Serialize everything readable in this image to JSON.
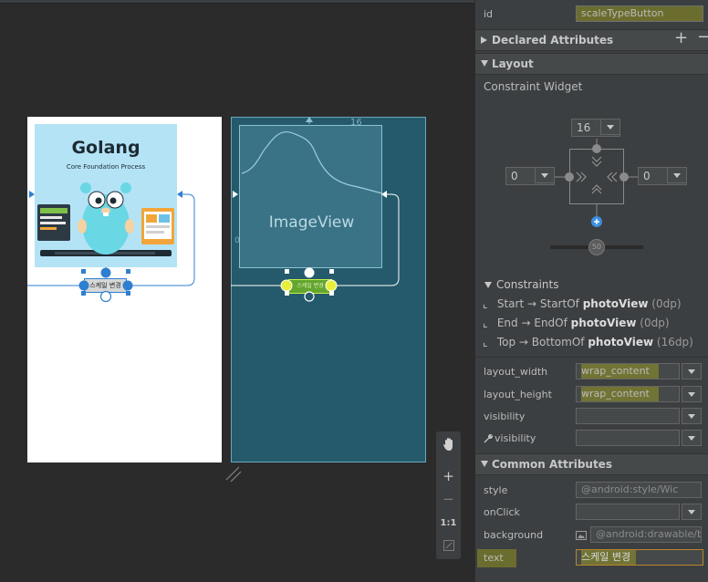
{
  "canvas": {
    "design": {
      "photo_title": "Golang",
      "photo_subtitle": "Core Foundation Process",
      "button_text": "스케일 변경"
    },
    "blueprint": {
      "image_label": "ImageView",
      "button_text": "스케일 변경",
      "top_margin": "16",
      "side_margin": "0"
    },
    "zoom": {
      "zoom_in": "+",
      "zoom_out": "−",
      "one_to_one": "1:1"
    }
  },
  "panel": {
    "id_label": "id",
    "id_value": "scaleTypeButton",
    "declared_header": "Declared Attributes",
    "add_symbol": "+",
    "remove_symbol": "−",
    "layout_header": "Layout",
    "constraint_widget_label": "Constraint Widget",
    "margin_top": "16",
    "margin_start": "0",
    "margin_end": "0",
    "bias": "50",
    "constraints_header": "Constraints",
    "constraints": [
      {
        "anchor": "Start",
        "arrow": "→",
        "target": "StartOf",
        "view": "photoView",
        "value": "(0dp)"
      },
      {
        "anchor": "End",
        "arrow": "→",
        "target": "EndOf",
        "view": "photoView",
        "value": "(0dp)"
      },
      {
        "anchor": "Top",
        "arrow": "→",
        "target": "BottomOf",
        "view": "photoView",
        "value": "(16dp)"
      }
    ],
    "layout_width_label": "layout_width",
    "layout_width_value": "wrap_content",
    "layout_height_label": "layout_height",
    "layout_height_value": "wrap_content",
    "visibility_label": "visibility",
    "tools_visibility_label": "visibility",
    "common_header": "Common Attributes",
    "style_label": "style",
    "style_value": "@android:style/Wic",
    "onclick_label": "onClick",
    "background_label": "background",
    "background_value": "@android:drawable/b",
    "text_label": "text",
    "text_value": "스케일 변경"
  },
  "colors": {
    "highlight": "#e6e600",
    "blueprint_bg": "#245a6b",
    "selection_blue": "#2f7fd0",
    "selected_green": "#63a52e"
  }
}
